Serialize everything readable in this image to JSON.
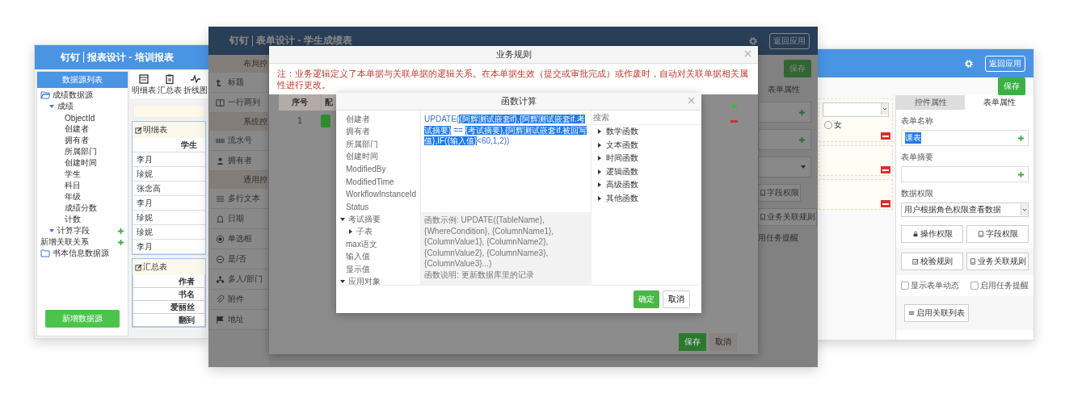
{
  "left_window": {
    "app": "钉钉",
    "title": "报表设计 - 培训报表",
    "sidebar": {
      "title": "数据源列表",
      "add_button": "新增数据源",
      "tree": [
        {
          "label": "成绩数据源",
          "kind": "folder",
          "expanded": true,
          "children": [
            {
              "label": "成绩",
              "kind": "group",
              "expanded": true,
              "children": [
                {
                  "label": "ObjectId",
                  "kind": "field"
                },
                {
                  "label": "创建者",
                  "kind": "field"
                },
                {
                  "label": "拥有者",
                  "kind": "field"
                },
                {
                  "label": "所属部门",
                  "kind": "field"
                },
                {
                  "label": "创建时间",
                  "kind": "field"
                },
                {
                  "label": "学生",
                  "kind": "field"
                },
                {
                  "label": "科目",
                  "kind": "field"
                },
                {
                  "label": "年级",
                  "kind": "field"
                },
                {
                  "label": "成绩分数",
                  "kind": "field"
                },
                {
                  "label": "计数",
                  "kind": "field"
                }
              ]
            },
            {
              "label": "计算字段",
              "kind": "group",
              "expanded": true,
              "addable": true
            }
          ]
        },
        {
          "label": "新增关联关系",
          "kind": "action",
          "addable": true
        },
        {
          "label": "书本信息数据源",
          "kind": "folder",
          "expanded": false
        }
      ]
    },
    "toolbar": [
      {
        "label": "明细表",
        "kind": "table"
      },
      {
        "label": "汇总表",
        "kind": "clipboard"
      },
      {
        "label": "折线图",
        "kind": "chart"
      }
    ],
    "detail_table": {
      "title": "明细表",
      "column": "学生",
      "rows": [
        "李月",
        "珍妮",
        "张念高",
        "李月",
        "珍妮",
        "珍妮",
        "李月"
      ]
    },
    "summary_table": {
      "title": "汇总表",
      "rows": [
        "作者",
        "书名",
        "爱丽丝",
        "翻到"
      ]
    }
  },
  "middle_window": {
    "app": "钉钉",
    "title": "表单设计 - 学生成绩表",
    "return_button": "返回应用",
    "palette": [
      {
        "kind": "header",
        "label": "布局控"
      },
      {
        "kind": "item",
        "label": "标题"
      },
      {
        "kind": "item",
        "label": "一行两列"
      },
      {
        "kind": "header",
        "label": "系统控"
      },
      {
        "kind": "item",
        "label": "流水号"
      },
      {
        "kind": "item",
        "label": "拥有者"
      },
      {
        "kind": "header",
        "label": "通用控"
      },
      {
        "kind": "item",
        "label": "多行文本"
      },
      {
        "kind": "item",
        "label": "日期"
      },
      {
        "kind": "item",
        "label": "单选框"
      },
      {
        "kind": "item",
        "label": "是/否"
      },
      {
        "kind": "item",
        "label": "多人/部门"
      },
      {
        "kind": "item",
        "label": "附件"
      },
      {
        "kind": "item",
        "label": "地址"
      }
    ],
    "save_button": "保存",
    "properties_tab": "表单属性",
    "field_permission_button": "字段权限",
    "rule_button": "业务关联规则",
    "reminder": "用任务提醒"
  },
  "rule_dialog": {
    "title": "业务规则",
    "note": "注：业务逻辑定义了本单据与关联单据的逻辑关系。在本单据生效（提交或审批完成）或作废时，自动对关联单据相关属性进行更改。",
    "columns": [
      "序号",
      "配"
    ],
    "rows": [
      {
        "index": "1"
      }
    ],
    "buttons": [
      "保存",
      "取消"
    ]
  },
  "function_dialog": {
    "title": "函数计算",
    "fields": [
      {
        "label": "创建者"
      },
      {
        "label": "拥有者"
      },
      {
        "label": "所属部门"
      },
      {
        "label": "创建时间"
      },
      {
        "label": "ModifiedBy"
      },
      {
        "label": "ModifiedTime"
      },
      {
        "label": "WorkflowInstanceId"
      },
      {
        "label": "Status"
      },
      {
        "label": "考试摘要",
        "expanded": true,
        "children": [
          {
            "label": "子表",
            "expanded": false
          }
        ]
      },
      {
        "label": "max语文"
      },
      {
        "label": "输入值"
      },
      {
        "label": "显示值"
      },
      {
        "label": "应用对象",
        "expanded": true
      }
    ],
    "formula": [
      {
        "text": "UPDATE(",
        "highlighted": false
      },
      {
        "text": "{阿辉测试嵌套if},{阿辉测试嵌套if.考试摘要}",
        "highlighted": true
      },
      {
        "text": " == ",
        "highlighted": false
      },
      {
        "text": "{考试摘要},{阿辉测试嵌套if.被回写值},IF({输入值}",
        "highlighted": true
      },
      {
        "text": "<60,1,2))",
        "highlighted": false
      }
    ],
    "example": "函数示例: UPDATE({TableName}, {WhereCondition}, {ColumnName1}, {ColumnValue1}, {ColumnName2}, {ColumnValue2}, {ColumnName3}, {ColumnValue3}...)",
    "description": "函数说明: 更新数据库里的记录",
    "search": {
      "placeholder": "搜索"
    },
    "categories": [
      "数学函数",
      "文本函数",
      "时间函数",
      "逻辑函数",
      "高级函数",
      "其他函数"
    ],
    "confirm_button": "确定",
    "cancel_button": "取消"
  },
  "right_window": {
    "return_button": "返回应用",
    "save_button": "保存",
    "radio": {
      "label": "女",
      "checked": false
    },
    "tabs": [
      {
        "label": "控件属性",
        "selected": false
      },
      {
        "label": "表单属性",
        "selected": true
      }
    ],
    "form_name": {
      "label": "表单名称",
      "value": "课表"
    },
    "form_summary": {
      "label": "表单摘要"
    },
    "data_permission": {
      "label": "数据权限",
      "value": "用户根据角色权限查看数据"
    },
    "buttons": [
      {
        "label": "操作权限",
        "kind": "lock"
      },
      {
        "label": "字段权限",
        "kind": "doc"
      },
      {
        "label": "校验规则",
        "kind": "check"
      },
      {
        "label": "业务关联规则",
        "kind": "doc"
      }
    ],
    "checkboxes": [
      {
        "label": "显示表单动态",
        "checked": false
      },
      {
        "label": "启用任务提醒",
        "checked": false
      }
    ],
    "list_button": "启用关联列表"
  }
}
